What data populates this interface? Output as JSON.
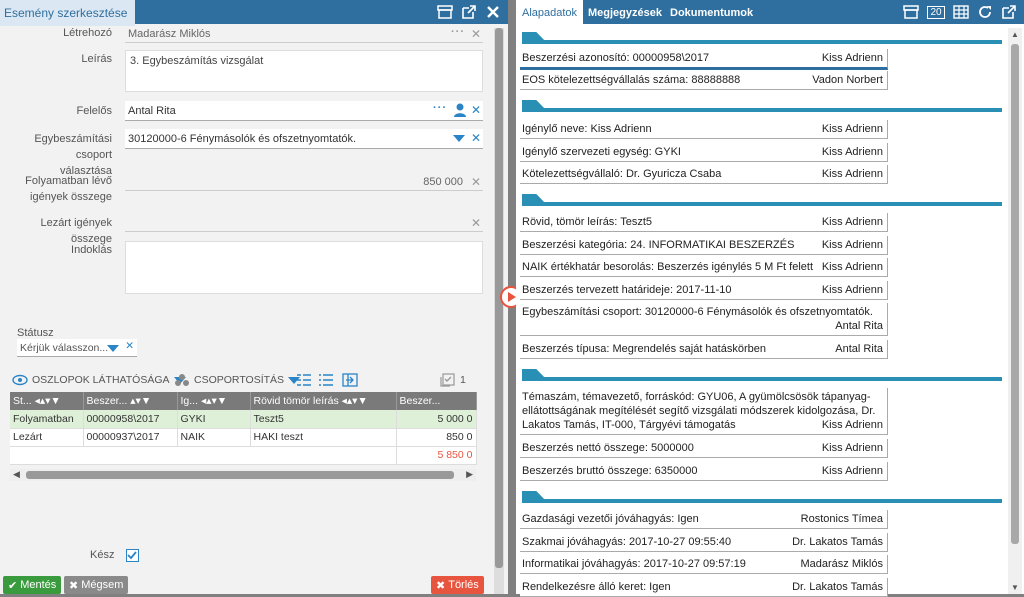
{
  "left": {
    "title": "Esemény szerkesztése",
    "fields": {
      "letrehozo_label": "Létrehozó",
      "letrehozo_value": "Madarász Miklós",
      "leiras_label": "Leírás",
      "leiras_value": "3. Egybeszámítás vizsgálat",
      "felelos_label": "Felelős",
      "felelos_value": "Antal Rita",
      "csoport_label_1": "Egybeszámítási csoport",
      "csoport_label_2": "választása",
      "csoport_value": "30120000-6 Fénymásolók és ofszetnyomtatók.",
      "folyamat_label_1": "Folyamatban lévő",
      "folyamat_label_2": "igények összege",
      "folyamat_value": "850 000",
      "lezart_label": "Lezárt igények összege",
      "indoklas_label": "Indoklás",
      "statusz_label": "Státusz",
      "statusz_placeholder": "Kérjük válasszon...",
      "kesz_label": "Kész"
    },
    "grid_toolbar": {
      "columns_label": "OSZLOPOK LÁTHATÓSÁGA",
      "grouping_label": "CSOPORTOSÍTÁS",
      "count": "1"
    },
    "grid": {
      "headers": [
        "St...",
        "Beszer...",
        "Ig...",
        "Rövid tömör leírás",
        "Beszer..."
      ],
      "rows": [
        [
          "Folyamatban",
          "00000958\\2017",
          "GYKI",
          "Teszt5",
          "5 000 0"
        ],
        [
          "Lezárt",
          "00000937\\2017",
          "NAIK",
          "HAKI teszt",
          "850 0"
        ]
      ],
      "total": "5 850 0"
    },
    "buttons": {
      "save": "Mentés",
      "cancel": "Mégsem",
      "delete": "Törlés"
    }
  },
  "right": {
    "tabs": [
      "Alapadatok",
      "Megjegyzések",
      "Dokumentumok"
    ],
    "badge": "20",
    "rows": [
      {
        "text": "Beszerzési azonosító: 00000958\\2017",
        "person": "Kiss Adrienn"
      },
      {
        "text": "EOS kötelezettségvállalás száma: 88888888",
        "person": "Vadon Norbert"
      },
      {
        "text": "Igénylő neve: Kiss Adrienn",
        "person": "Kiss Adrienn"
      },
      {
        "text": "Igénylő szervezeti egység: GYKI",
        "person": "Kiss Adrienn"
      },
      {
        "text": "Kötelezettségvállaló: Dr. Gyuricza Csaba",
        "person": "Kiss Adrienn"
      },
      {
        "text": "Rövid, tömör leírás: Teszt5",
        "person": "Kiss Adrienn"
      },
      {
        "text": "Beszerzési kategória: 24. INFORMATIKAI BESZERZÉS",
        "person": "Kiss Adrienn"
      },
      {
        "text": "NAIK értékhatár besorolás: Beszerzés igénylés 5 M Ft felett",
        "person": "Kiss Adrienn"
      },
      {
        "text": "Beszerzés tervezett határideje: 2017-11-10",
        "person": "Kiss Adrienn"
      },
      {
        "text": "Egybeszámítási csoport: 30120000-6 Fénymásolók és ofszetnyomtatók.",
        "person": "Antal Rita"
      },
      {
        "text": "Beszerzés típusa: Megrendelés saját hatáskörben",
        "person": "Antal Rita"
      },
      {
        "text": "Témaszám, témavezető, forráskód: GYU06, A gyümölcsösök tápanyag-ellátottságának megítélését segítő vizsgálati módszerek kidolgozása, Dr. Lakatos Tamás, IT-000, Tárgyévi támogatás",
        "person": "Kiss Adrienn"
      },
      {
        "text": "Beszerzés nettó összege: 5000000",
        "person": "Kiss Adrienn"
      },
      {
        "text": "Beszerzés bruttó összege: 6350000",
        "person": "Kiss Adrienn"
      },
      {
        "text": "Gazdasági vezetői jóváhagyás: Igen",
        "person": "Rostonics Tímea"
      },
      {
        "text": "Szakmai jóváhagyás: 2017-10-27 09:55:40",
        "person": "Dr. Lakatos Tamás"
      },
      {
        "text": "Informatikai jóváhagyás: 2017-10-27 09:57:19",
        "person": "Madarász Miklós"
      },
      {
        "text": "Rendelkezésre álló keret: Igen",
        "person": "Dr. Lakatos Tamás"
      }
    ]
  },
  "colors": {
    "header": "#2f6f9f",
    "accent": "#2a84c6",
    "section": "#2a8fb5",
    "save": "#3a9a3e",
    "delete": "#e8553f",
    "cancel": "#8a8a8a"
  }
}
